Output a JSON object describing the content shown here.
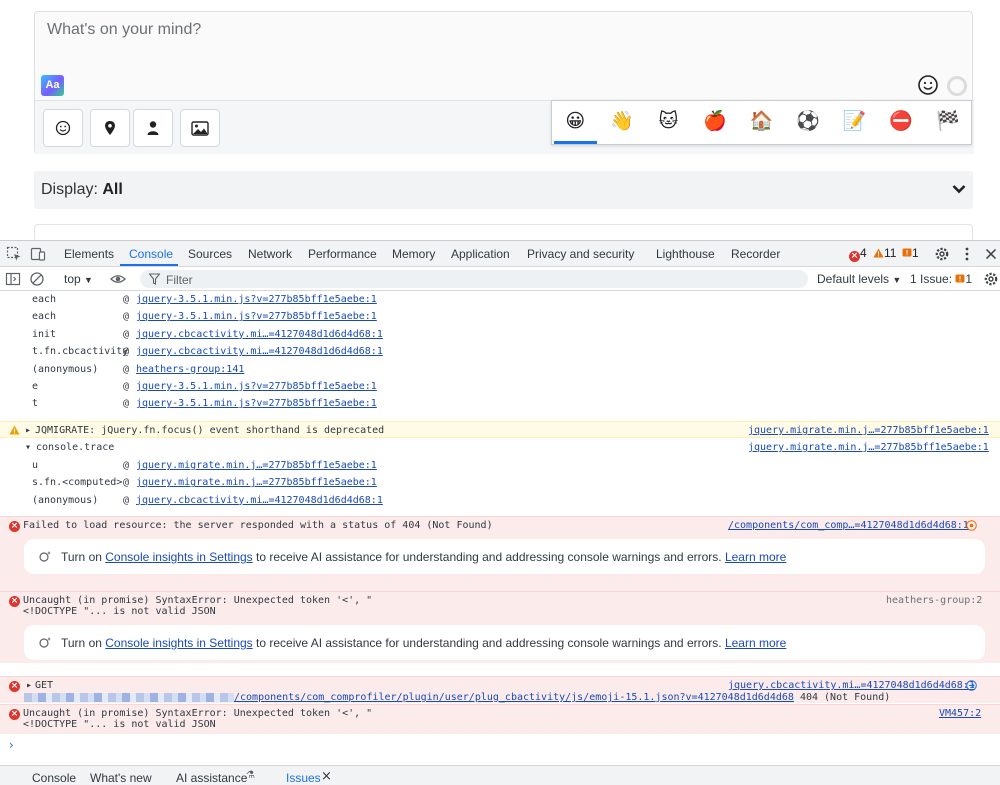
{
  "composer": {
    "placeholder": "What's on your mind?",
    "format_badge": "Aa",
    "tools": [
      {
        "name": "emoji-icon"
      },
      {
        "name": "location-pin-icon"
      },
      {
        "name": "person-icon"
      },
      {
        "name": "image-icon"
      }
    ]
  },
  "emoji_tabs": [
    "😀",
    "👋",
    "🐱",
    "🍎",
    "🏠",
    "⚽",
    "📝",
    "⛔",
    "🏁"
  ],
  "display": {
    "label": "Display:",
    "value": "All"
  },
  "devtools": {
    "tabs": [
      "Elements",
      "Console",
      "Sources",
      "Network",
      "Performance",
      "Memory",
      "Application",
      "Privacy and security",
      "Lighthouse",
      "Recorder"
    ],
    "active_tab": "Console",
    "error_count": "4",
    "warning_count": "11",
    "issue_count": "1",
    "toolbar": {
      "context": "top",
      "filter_placeholder": "Filter",
      "levels": "Default levels",
      "issues": "1 Issue:",
      "issues_count": "1"
    },
    "drawer_tabs": [
      "Console",
      "What's new",
      "AI assistance",
      "Issues"
    ]
  },
  "console": {
    "trace1": [
      {
        "fn": "each",
        "src": "jquery-3.5.1.min.js?v=277b85bff1e5aebe:1"
      },
      {
        "fn": "each",
        "src": "jquery-3.5.1.min.js?v=277b85bff1e5aebe:1"
      },
      {
        "fn": "init",
        "src": "jquery.cbcactivity.mi…=4127048d1d6d4d68:1"
      },
      {
        "fn": "t.fn.cbcactivity",
        "src": "jquery.cbcactivity.mi…=4127048d1d6d4d68:1"
      },
      {
        "fn": "(anonymous)",
        "src": "heathers-group:141"
      },
      {
        "fn": "e",
        "src": "jquery-3.5.1.min.js?v=277b85bff1e5aebe:1"
      },
      {
        "fn": "t",
        "src": "jquery-3.5.1.min.js?v=277b85bff1e5aebe:1"
      }
    ],
    "warning": {
      "text": "JQMIGRATE: jQuery.fn.focus() event shorthand is deprecated",
      "src": "jquery.migrate.min.j…=277b85bff1e5aebe:1"
    },
    "trace_header": {
      "text": "console.trace",
      "src": "jquery.migrate.min.j…=277b85bff1e5aebe:1"
    },
    "trace2": [
      {
        "fn": "u",
        "src": "jquery.migrate.min.j…=277b85bff1e5aebe:1"
      },
      {
        "fn": "s.fn.<computed>",
        "src": "jquery.migrate.min.j…=277b85bff1e5aebe:1"
      },
      {
        "fn": "(anonymous)",
        "src": "jquery.cbcactivity.mi…=4127048d1d6d4d68:1"
      }
    ],
    "error1": {
      "text": "Failed to load resource: the server responded with a status of 404 (Not Found)",
      "src": "/components/com_comp…=4127048d1d6d4d68:1"
    },
    "insight": {
      "prefix": "Turn on ",
      "link": "Console insights in Settings",
      "middle": " to receive AI assistance for understanding and addressing console warnings and errors. ",
      "learn": "Learn more"
    },
    "error2": {
      "line1": "Uncaught (in promise) SyntaxError: Unexpected token '<', \"",
      "line2": "<!DOCTYPE \"... is not valid JSON",
      "src": "heathers-group:2"
    },
    "error3": {
      "method": "GET",
      "src": "jquery.cbcactivity.mi…=4127048d1d6d4d68:1",
      "url": "/components/com_comprofiler/plugin/user/plug_cbactivity/js/emoji-15.1.json?v=4127048d1d6d4d68",
      "status": "404 (Not Found)"
    },
    "error4": {
      "line1": "Uncaught (in promise) SyntaxError: Unexpected token '<', \"",
      "line2": "<!DOCTYPE \"... is not valid JSON",
      "src": "VM457:2"
    },
    "prompt": "›"
  },
  "colors": {
    "accent": "#1a73e8",
    "error": "#dc362e",
    "warning": "#e8a200"
  }
}
